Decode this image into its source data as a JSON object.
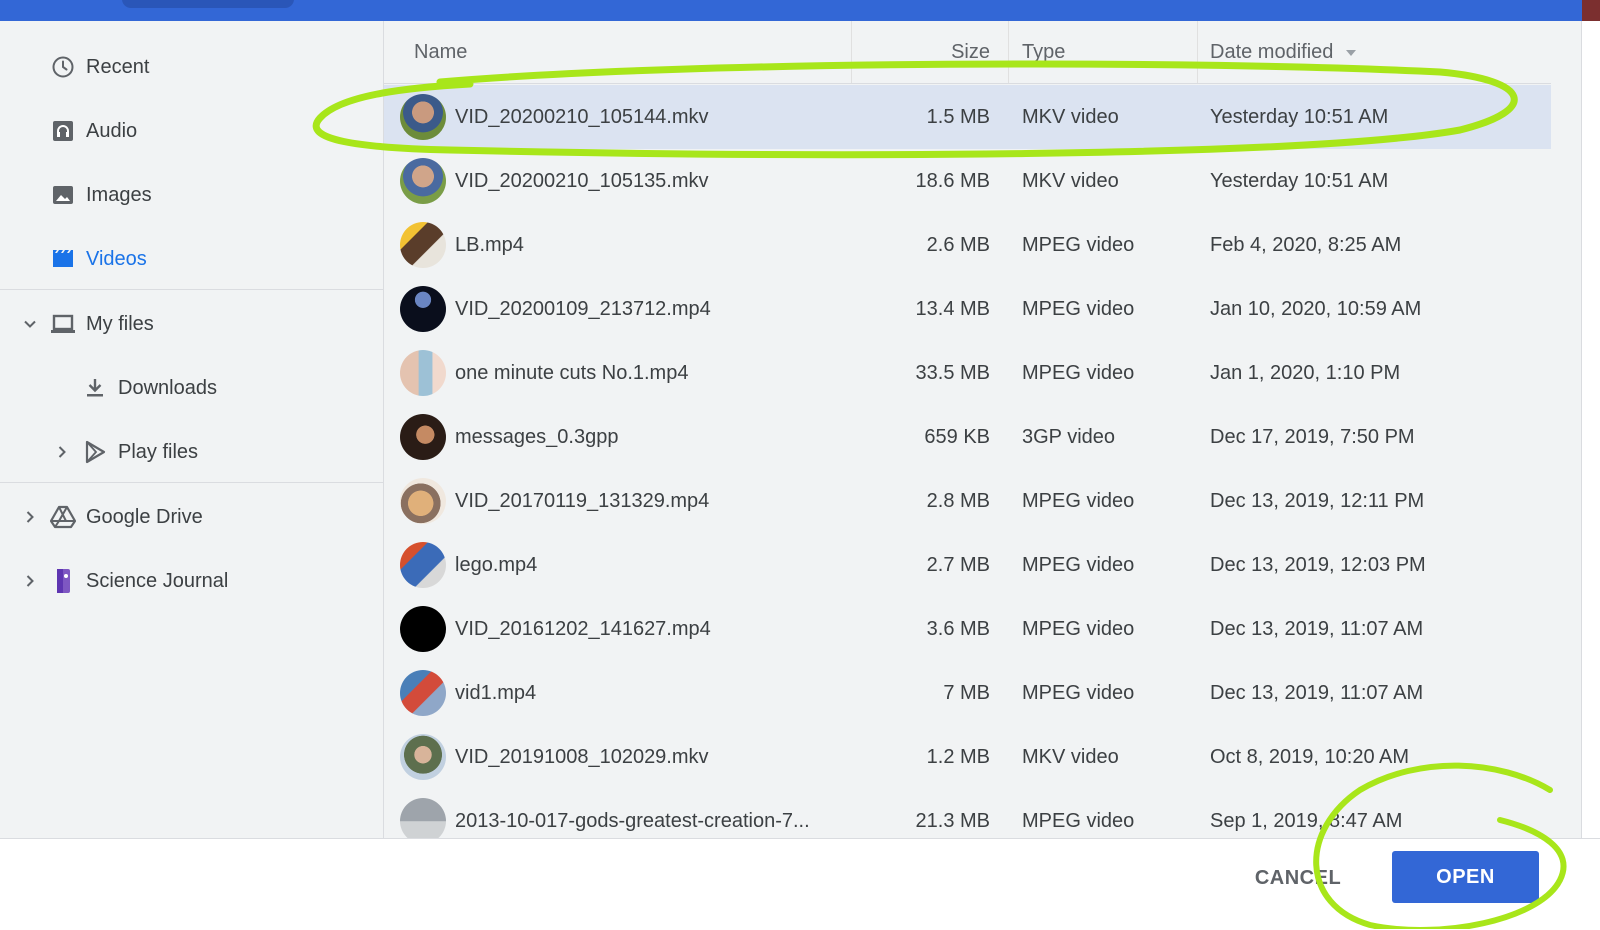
{
  "colors": {
    "accent": "#1a73e8",
    "topbar": "#3367d6",
    "selected_row": "#dbe3f1",
    "annotation": "#a8e61a"
  },
  "sidebar": {
    "items": [
      {
        "label": "Recent",
        "icon": "clock-icon"
      },
      {
        "label": "Audio",
        "icon": "audio-icon"
      },
      {
        "label": "Images",
        "icon": "image-icon"
      },
      {
        "label": "Videos",
        "icon": "video-icon",
        "active": true
      },
      {
        "label": "My files",
        "icon": "laptop-icon",
        "expanded": true
      },
      {
        "label": "Downloads",
        "icon": "download-icon"
      },
      {
        "label": "Play files",
        "icon": "play-files-icon"
      },
      {
        "label": "Google Drive",
        "icon": "google-drive-icon"
      },
      {
        "label": "Science Journal",
        "icon": "science-journal-icon"
      }
    ]
  },
  "table": {
    "headers": {
      "name": "Name",
      "size": "Size",
      "type": "Type",
      "date": "Date modified"
    },
    "rows": [
      {
        "name": "VID_20200210_105144.mkv",
        "size": "1.5 MB",
        "type": "MKV video",
        "date": "Yesterday 10:51 AM",
        "selected": true
      },
      {
        "name": "VID_20200210_105135.mkv",
        "size": "18.6 MB",
        "type": "MKV video",
        "date": "Yesterday 10:51 AM"
      },
      {
        "name": "LB.mp4",
        "size": "2.6 MB",
        "type": "MPEG video",
        "date": "Feb 4, 2020, 8:25 AM"
      },
      {
        "name": "VID_20200109_213712.mp4",
        "size": "13.4 MB",
        "type": "MPEG video",
        "date": "Jan 10, 2020, 10:59 AM"
      },
      {
        "name": "one minute cuts No.1.mp4",
        "size": "33.5 MB",
        "type": "MPEG video",
        "date": "Jan 1, 2020, 1:10 PM"
      },
      {
        "name": "messages_0.3gpp",
        "size": "659 KB",
        "type": "3GP video",
        "date": "Dec 17, 2019, 7:50 PM"
      },
      {
        "name": "VID_20170119_131329.mp4",
        "size": "2.8 MB",
        "type": "MPEG video",
        "date": "Dec 13, 2019, 12:11 PM"
      },
      {
        "name": "lego.mp4",
        "size": "2.7 MB",
        "type": "MPEG video",
        "date": "Dec 13, 2019, 12:03 PM"
      },
      {
        "name": "VID_20161202_141627.mp4",
        "size": "3.6 MB",
        "type": "MPEG video",
        "date": "Dec 13, 2019, 11:07 AM"
      },
      {
        "name": "vid1.mp4",
        "size": "7 MB",
        "type": "MPEG video",
        "date": "Dec 13, 2019, 11:07 AM"
      },
      {
        "name": "VID_20191008_102029.mkv",
        "size": "1.2 MB",
        "type": "MKV video",
        "date": "Oct 8, 2019, 10:20 AM"
      },
      {
        "name": "2013-10-017-gods-greatest-creation-7...",
        "size": "21.3 MB",
        "type": "MPEG video",
        "date": "Sep 1, 2019, 8:47 AM"
      }
    ]
  },
  "footer": {
    "cancel_label": "CANCEL",
    "open_label": "OPEN"
  }
}
